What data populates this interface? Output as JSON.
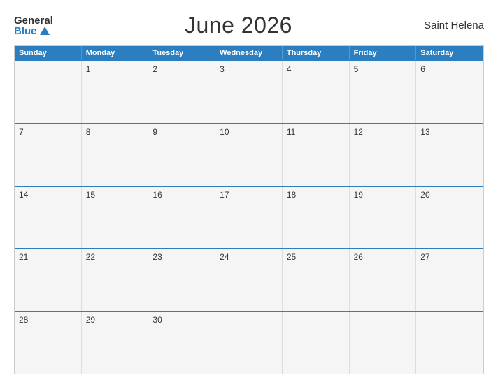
{
  "header": {
    "logo_general": "General",
    "logo_blue": "Blue",
    "title": "June 2026",
    "region": "Saint Helena"
  },
  "calendar": {
    "day_headers": [
      "Sunday",
      "Monday",
      "Tuesday",
      "Wednesday",
      "Thursday",
      "Friday",
      "Saturday"
    ],
    "weeks": [
      [
        {
          "day": "",
          "empty": true
        },
        {
          "day": "1"
        },
        {
          "day": "2"
        },
        {
          "day": "3"
        },
        {
          "day": "4"
        },
        {
          "day": "5"
        },
        {
          "day": "6"
        }
      ],
      [
        {
          "day": "7"
        },
        {
          "day": "8"
        },
        {
          "day": "9"
        },
        {
          "day": "10"
        },
        {
          "day": "11"
        },
        {
          "day": "12"
        },
        {
          "day": "13"
        }
      ],
      [
        {
          "day": "14"
        },
        {
          "day": "15"
        },
        {
          "day": "16"
        },
        {
          "day": "17"
        },
        {
          "day": "18"
        },
        {
          "day": "19"
        },
        {
          "day": "20"
        }
      ],
      [
        {
          "day": "21"
        },
        {
          "day": "22"
        },
        {
          "day": "23"
        },
        {
          "day": "24"
        },
        {
          "day": "25"
        },
        {
          "day": "26"
        },
        {
          "day": "27"
        }
      ],
      [
        {
          "day": "28"
        },
        {
          "day": "29"
        },
        {
          "day": "30"
        },
        {
          "day": "",
          "empty": true
        },
        {
          "day": "",
          "empty": true
        },
        {
          "day": "",
          "empty": true
        },
        {
          "day": "",
          "empty": true
        }
      ]
    ]
  }
}
